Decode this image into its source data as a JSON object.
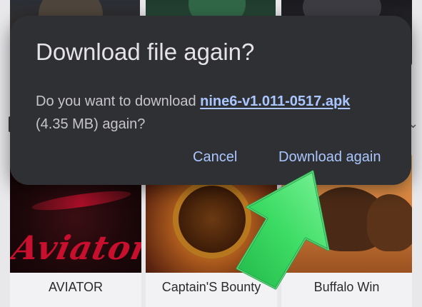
{
  "dialog": {
    "title": "Download file again?",
    "body_prefix": "Do you want to download ",
    "file_name": "nine6-v1.011-0517.apk",
    "body_suffix": "(4.35 MB) again?",
    "cancel_label": "Cancel",
    "download_again_label": "Download again"
  },
  "games": [
    {
      "title": "AVIATOR",
      "art_text": "Aviator"
    },
    {
      "title": "Captain'S Bounty"
    },
    {
      "title": "Buffalo Win"
    }
  ],
  "colors": {
    "dialog_bg": "#2f3033",
    "accent": "#aac6ff",
    "arrow_green": "#3ddc64"
  },
  "icons": {
    "section_chevron": "chevron-down-icon",
    "pointer_arrow": "green-arrow-icon"
  }
}
